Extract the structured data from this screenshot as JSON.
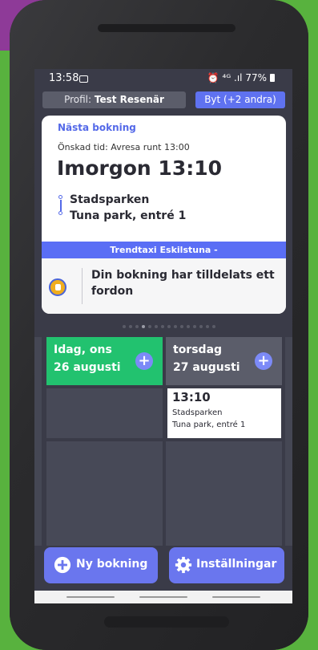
{
  "status_bar": {
    "time": "13:58",
    "right_text": "⏰ ⁴ᴳ .ıl 77%"
  },
  "profile": {
    "prefix": "Profil:",
    "name": "Test Resenär",
    "switch_label": "Byt (+2 andra)"
  },
  "next_booking": {
    "label": "Nästa bokning",
    "desired_time": "Önskad tid: Avresa runt 13:00",
    "when": "Imorgon 13:10",
    "from": "Stadsparken",
    "to": "Tuna park, entré 1",
    "operator": "Trendtaxi Eskilstuna  -",
    "status": "Din bokning har tilldelats ett fordon"
  },
  "days": [
    {
      "line1": "Idag, ons",
      "line2": "26 augusti",
      "plus": "+"
    },
    {
      "line1": "torsdag",
      "line2": "27 augusti",
      "plus": "+"
    }
  ],
  "booking_entry": {
    "time": "13:10",
    "from": "Stadsparken",
    "to": "Tuna park, entré 1"
  },
  "actions": {
    "new_booking": "Ny bokning",
    "settings": "Inställningar"
  },
  "colors": {
    "accent": "#5f72f0",
    "today": "#22c26f",
    "badge": "#8e3a98",
    "background": "#58b23e"
  }
}
